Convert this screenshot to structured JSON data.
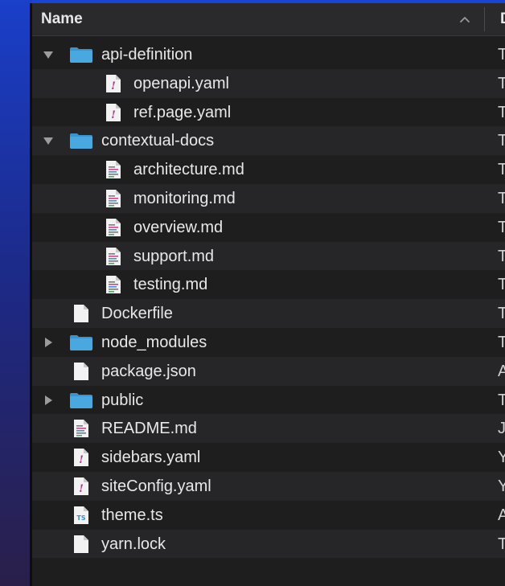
{
  "header": {
    "name_label": "Name",
    "next_column_label": "D"
  },
  "rows": [
    {
      "label": "api-definition",
      "type": "folder",
      "state": "expanded",
      "depth": 0,
      "icon": "folder-icon",
      "trailing": "T"
    },
    {
      "label": "openapi.yaml",
      "type": "yaml",
      "depth": 1,
      "icon": "yaml-file-icon",
      "trailing": "T"
    },
    {
      "label": "ref.page.yaml",
      "type": "yaml",
      "depth": 1,
      "icon": "yaml-file-icon",
      "trailing": "T"
    },
    {
      "label": "contextual-docs",
      "type": "folder",
      "state": "expanded",
      "depth": 0,
      "icon": "folder-icon",
      "trailing": "T"
    },
    {
      "label": "architecture.md",
      "type": "md",
      "depth": 1,
      "icon": "markdown-file-icon",
      "trailing": "T"
    },
    {
      "label": "monitoring.md",
      "type": "md",
      "depth": 1,
      "icon": "markdown-file-icon",
      "trailing": "T"
    },
    {
      "label": "overview.md",
      "type": "md",
      "depth": 1,
      "icon": "markdown-file-icon",
      "trailing": "T"
    },
    {
      "label": "support.md",
      "type": "md",
      "depth": 1,
      "icon": "markdown-file-icon",
      "trailing": "T"
    },
    {
      "label": "testing.md",
      "type": "md",
      "depth": 1,
      "icon": "markdown-file-icon",
      "trailing": "T"
    },
    {
      "label": "Dockerfile",
      "type": "file",
      "depth": 0,
      "icon": "document-icon",
      "trailing": "T"
    },
    {
      "label": "node_modules",
      "type": "folder",
      "state": "collapsed",
      "depth": 0,
      "icon": "folder-icon",
      "trailing": "T"
    },
    {
      "label": "package.json",
      "type": "file",
      "depth": 0,
      "icon": "document-icon",
      "trailing": "A"
    },
    {
      "label": "public",
      "type": "folder",
      "state": "collapsed",
      "depth": 0,
      "icon": "folder-icon",
      "trailing": "T"
    },
    {
      "label": "README.md",
      "type": "md",
      "depth": 0,
      "icon": "markdown-file-icon",
      "trailing": "J"
    },
    {
      "label": "sidebars.yaml",
      "type": "yaml",
      "depth": 0,
      "icon": "yaml-file-icon",
      "trailing": "Y"
    },
    {
      "label": "siteConfig.yaml",
      "type": "yaml",
      "depth": 0,
      "icon": "yaml-file-icon",
      "trailing": "Y"
    },
    {
      "label": "theme.ts",
      "type": "ts",
      "depth": 0,
      "icon": "typescript-file-icon",
      "icon_text": "TS",
      "trailing": "A"
    },
    {
      "label": "yarn.lock",
      "type": "file",
      "depth": 0,
      "icon": "document-icon",
      "trailing": "T"
    }
  ],
  "colors": {
    "folder": "#4aa8e0",
    "folder_tab": "#3a95cf",
    "yaml_mark": "#b0318b",
    "ts_text": "#3a8fd0",
    "text": "#e8e8e8",
    "stripe": "#262628"
  }
}
